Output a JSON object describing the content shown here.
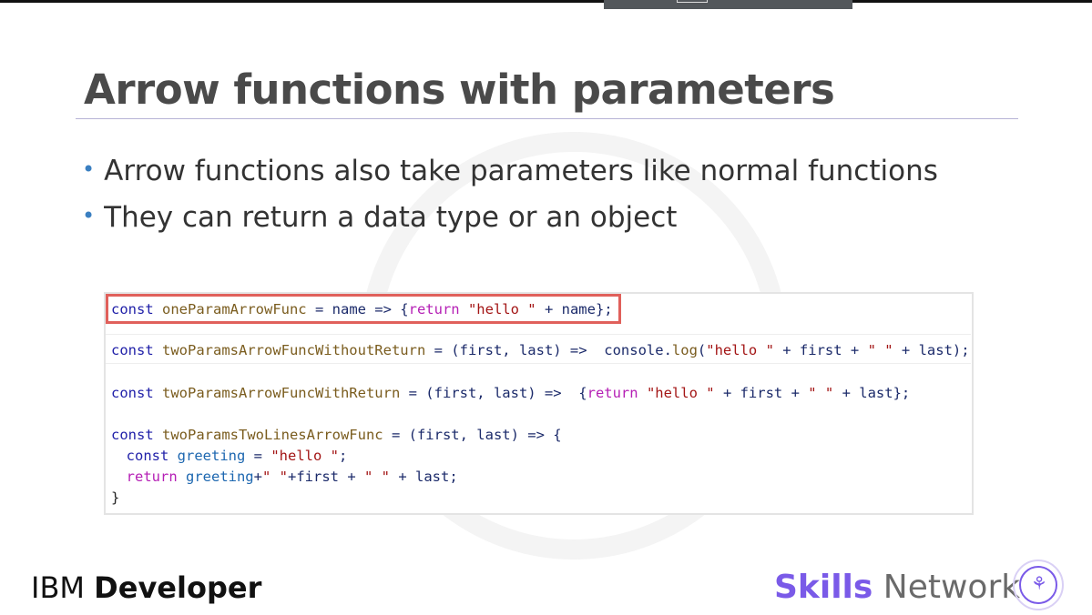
{
  "slide": {
    "title": "Arrow functions with parameters",
    "bullets": [
      "Arrow functions also take parameters like normal functions",
      "They can return a data type or an object"
    ]
  },
  "code": {
    "highlight_color": "#e0605b",
    "l1": {
      "a": "const",
      "b": " oneParamArrowFunc",
      "c": " = name => {",
      "d": "return",
      "e": " \"hello \"",
      "f": " + name};"
    },
    "l2": {
      "a": "const",
      "b": " twoParamsArrowFuncWithoutReturn",
      "c": " = (first, last) =>  console.",
      "d": "log",
      "e": "(",
      "f": "\"hello \"",
      "g": " + first + ",
      "h": "\" \"",
      "i": " + last);"
    },
    "l3": {
      "a": "const",
      "b": " twoParamsArrowFuncWithReturn",
      "c": " = (first, last) =>  {",
      "d": "return",
      "e": " \"hello \"",
      "f": " + first + ",
      "g": "\" \"",
      "h": " + last};"
    },
    "l4": {
      "a": "const",
      "b": " twoParamsTwoLinesArrowFunc",
      "c": " = (first, last) => {"
    },
    "l5": {
      "a": "  const",
      "b": " greeting",
      "c": " = ",
      "d": "\"hello \"",
      "e": ";"
    },
    "l6": {
      "a": "  return",
      "b": " greeting",
      "c": "+",
      "d": "\" \"",
      "e": "+first + ",
      "f": "\" \"",
      "g": " + last;"
    },
    "l7": "}"
  },
  "footer": {
    "ibm": "IBM",
    "developer": "Developer",
    "skills": "Skills",
    "network": "Network",
    "brand_color": "#7a5ae8"
  }
}
